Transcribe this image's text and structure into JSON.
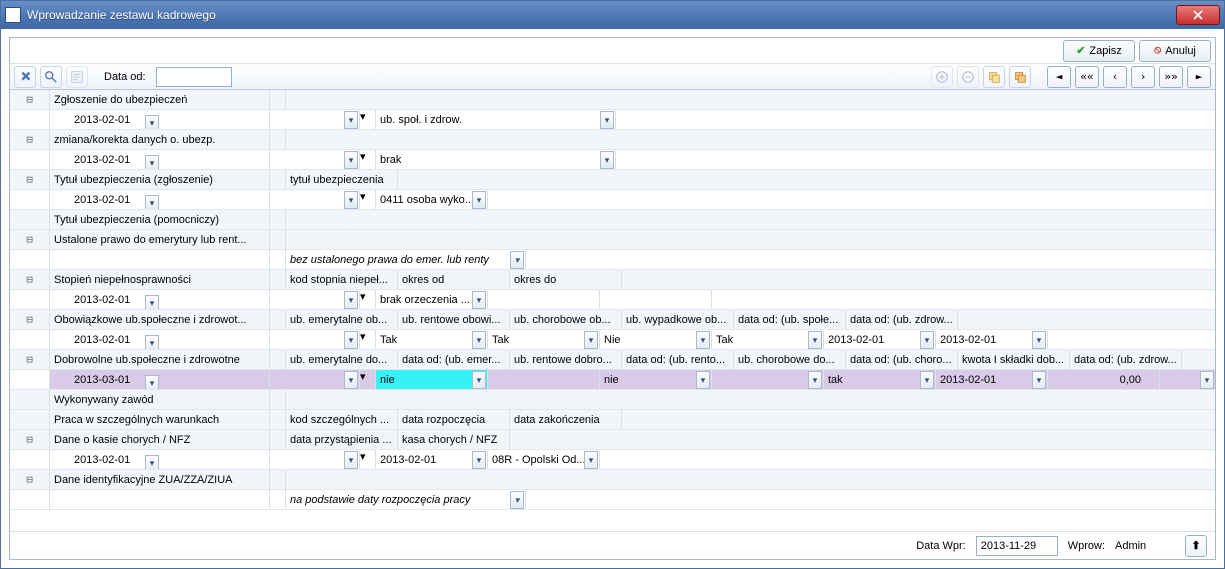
{
  "window": {
    "title": "Wprowadzanie zestawu kadrowego"
  },
  "actions": {
    "save": "Zapisz",
    "cancel": "Anuluj"
  },
  "toolbar": {
    "data_od_label": "Data od:",
    "data_od_value": ""
  },
  "footer": {
    "data_wpr_label": "Data Wpr:",
    "data_wpr_value": "2013-11-29",
    "wprow_label": "Wprow:",
    "wprow_value": "Admin"
  },
  "rows": {
    "r1": {
      "label": "Zgłoszenie do ubezpieczeń"
    },
    "r2": {
      "date": "2013-02-01",
      "val": "ub. społ. i zdrow."
    },
    "r3": {
      "label": "zmiana/korekta danych o. ubezp."
    },
    "r4": {
      "date": "2013-02-01",
      "val": "brak"
    },
    "r5": {
      "label": "Tytuł ubezpieczenia (zgłoszenie)",
      "hdr": "tytuł ubezpieczenia"
    },
    "r6": {
      "date": "2013-02-01",
      "val": "0411 osoba wyko..."
    },
    "r7": {
      "label": "Tytuł ubezpieczenia (pomocniczy)"
    },
    "r8": {
      "label": "Ustalone prawo do emerytury lub rent..."
    },
    "r9": {
      "val": "bez ustalonego prawa do emer. lub renty"
    },
    "r10": {
      "label": "Stopień niepełnosprawności",
      "h1": "kod stopnia niepeł...",
      "h2": "okres od",
      "h3": "okres do"
    },
    "r11": {
      "date": "2013-02-01",
      "val": "brak orzeczenia ..."
    },
    "r12": {
      "label": "Obowiązkowe ub.społeczne i zdrowot...",
      "h1": "ub. emerytalne ob...",
      "h2": "ub. rentowe obowi...",
      "h3": "ub. chorobowe ob...",
      "h4": "ub. wypadkowe ob...",
      "h5": "data od: (ub. społe...",
      "h6": "data od: (ub. zdrow..."
    },
    "r13": {
      "date": "2013-02-01",
      "v1": "Tak",
      "v2": "Tak",
      "v3": "Nie",
      "v4": "Tak",
      "d1": "2013-02-01",
      "d2": "2013-02-01"
    },
    "r14": {
      "label": "Dobrowolne ub.społeczne i zdrowotne",
      "h1": "ub. emerytalne do...",
      "h2": "data od: (ub. emer...",
      "h3": "ub. rentowe dobro...",
      "h4": "data od: (ub. rento...",
      "h5": "ub. chorobowe do...",
      "h6": "data od: (ub. choro...",
      "h7": "kwota I składki dob...",
      "h8": "data od: (ub. zdrow..."
    },
    "r15": {
      "date": "2013-03-01",
      "v1": "nie",
      "v2": "",
      "v3": "nie",
      "v4": "",
      "v5": "tak",
      "d1": "2013-02-01",
      "amt": "0,00"
    },
    "r16": {
      "label": "Wykonywany zawód"
    },
    "r17": {
      "label": "Praca w szczególnych warunkach",
      "h1": "kod szczególnych ...",
      "h2": "data rozpoczęcia",
      "h3": "data zakończenia"
    },
    "r18": {
      "label": "Dane o kasie chorych / NFZ",
      "h1": "data przystąpienia ...",
      "h2": "kasa chorych / NFZ"
    },
    "r19": {
      "date": "2013-02-01",
      "v1": "2013-02-01",
      "v2": "08R - Opolski Od..."
    },
    "r20": {
      "label": "Dane identyfikacyjne ZUA/ZZA/ZIUA"
    },
    "r21": {
      "val": "na podstawie daty rozpoczęcia pracy"
    }
  }
}
